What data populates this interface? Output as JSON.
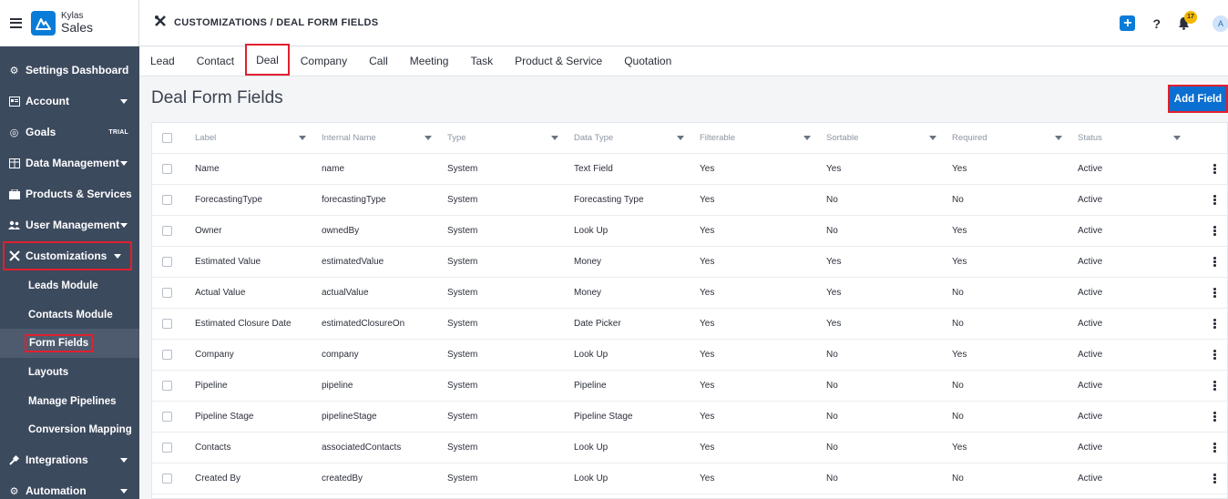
{
  "brand": {
    "top": "Kylas",
    "bottom": "Sales"
  },
  "header": {
    "title": "CUSTOMIZATIONS / DEAL FORM FIELDS",
    "notification_count": "17",
    "avatar_initial": "A",
    "help": "?"
  },
  "sidebar": {
    "items": [
      {
        "label": "Settings Dashboard",
        "icon": "gear-icon"
      },
      {
        "label": "Account",
        "icon": "account-icon",
        "caret": true
      },
      {
        "label": "Goals",
        "icon": "target-icon",
        "trial": "TRIAL"
      },
      {
        "label": "Data Management",
        "icon": "table-icon",
        "caret": true
      },
      {
        "label": "Products & Services",
        "icon": "box-icon"
      },
      {
        "label": "User Management",
        "icon": "users-icon",
        "caret": true
      },
      {
        "label": "Customizations",
        "icon": "tools-icon",
        "caret": true
      },
      {
        "label": "Integrations",
        "icon": "plug-icon",
        "caret": true
      },
      {
        "label": "Automation",
        "icon": "cogs-icon",
        "caret": true
      }
    ],
    "sub_items": [
      "Leads Module",
      "Contacts Module",
      "Form Fields",
      "Layouts",
      "Manage Pipelines",
      "Conversion Mapping"
    ]
  },
  "tabs": [
    "Lead",
    "Contact",
    "Deal",
    "Company",
    "Call",
    "Meeting",
    "Task",
    "Product & Service",
    "Quotation"
  ],
  "page": {
    "title": "Deal Form Fields",
    "add_button": "Add Field"
  },
  "table": {
    "columns": [
      "Label",
      "Internal Name",
      "Type",
      "Data Type",
      "Filterable",
      "Sortable",
      "Required",
      "Status"
    ],
    "rows": [
      [
        "Name",
        "name",
        "System",
        "Text Field",
        "Yes",
        "Yes",
        "Yes",
        "Active"
      ],
      [
        "ForecastingType",
        "forecastingType",
        "System",
        "Forecasting Type",
        "Yes",
        "No",
        "No",
        "Active"
      ],
      [
        "Owner",
        "ownedBy",
        "System",
        "Look Up",
        "Yes",
        "No",
        "Yes",
        "Active"
      ],
      [
        "Estimated Value",
        "estimatedValue",
        "System",
        "Money",
        "Yes",
        "Yes",
        "Yes",
        "Active"
      ],
      [
        "Actual Value",
        "actualValue",
        "System",
        "Money",
        "Yes",
        "Yes",
        "No",
        "Active"
      ],
      [
        "Estimated Closure Date",
        "estimatedClosureOn",
        "System",
        "Date Picker",
        "Yes",
        "Yes",
        "No",
        "Active"
      ],
      [
        "Company",
        "company",
        "System",
        "Look Up",
        "Yes",
        "No",
        "Yes",
        "Active"
      ],
      [
        "Pipeline",
        "pipeline",
        "System",
        "Pipeline",
        "Yes",
        "No",
        "No",
        "Active"
      ],
      [
        "Pipeline Stage",
        "pipelineStage",
        "System",
        "Pipeline Stage",
        "Yes",
        "No",
        "No",
        "Active"
      ],
      [
        "Contacts",
        "associatedContacts",
        "System",
        "Look Up",
        "Yes",
        "No",
        "Yes",
        "Active"
      ],
      [
        "Created By",
        "createdBy",
        "System",
        "Look Up",
        "Yes",
        "No",
        "No",
        "Active"
      ]
    ]
  }
}
